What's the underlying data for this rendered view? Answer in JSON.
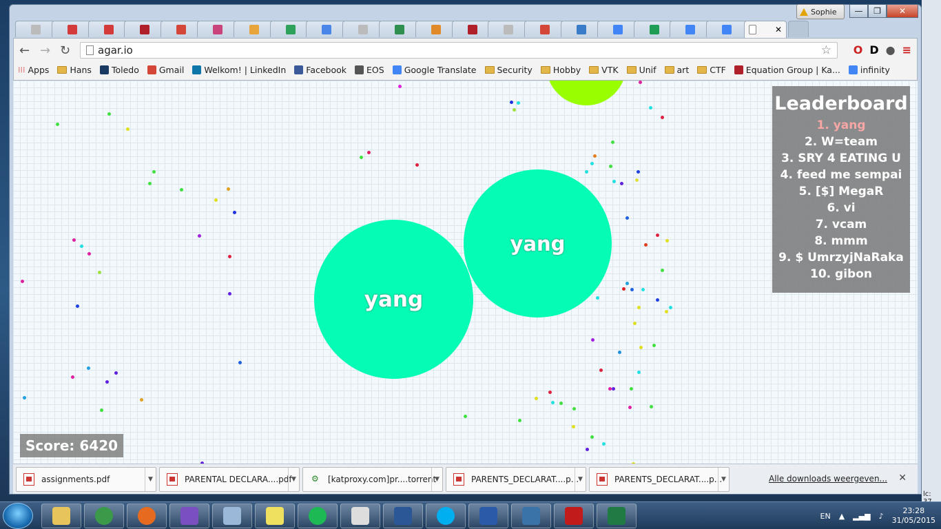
{
  "profile": {
    "name": "Sophie"
  },
  "window_controls": {
    "minimize": "—",
    "maximize": "❐",
    "close": "✕"
  },
  "tabs": [
    {
      "icon": "page-icon",
      "color": "#bbbbbb"
    },
    {
      "icon": "pdf-red-icon",
      "color": "#d33a3a"
    },
    {
      "icon": "pdf-red-icon",
      "color": "#d33a3a"
    },
    {
      "icon": "kaspersky-icon",
      "color": "#b0202a"
    },
    {
      "icon": "gmail-icon",
      "color": "#d44638"
    },
    {
      "icon": "barcode-icon",
      "color": "#c9447a"
    },
    {
      "icon": "pinwheel-icon",
      "color": "#e7a53b"
    },
    {
      "icon": "drive-icon",
      "color": "#2ea15a"
    },
    {
      "icon": "docs-icon",
      "color": "#4a86e8"
    },
    {
      "icon": "page-icon",
      "color": "#bbbbbb"
    },
    {
      "icon": "arrow-icon",
      "color": "#2f8f4e"
    },
    {
      "icon": "gear-icon",
      "color": "#e08a2a"
    },
    {
      "icon": "kaspersky-icon",
      "color": "#b0202a"
    },
    {
      "icon": "page-icon",
      "color": "#bbbbbb"
    },
    {
      "icon": "gmail-icon",
      "color": "#d44638"
    },
    {
      "icon": "home-icon",
      "color": "#3a7cc8"
    },
    {
      "icon": "google-icon",
      "color": "#4285f4"
    },
    {
      "icon": "sheets-icon",
      "color": "#1f9d55"
    },
    {
      "icon": "google-icon",
      "color": "#4285f4"
    },
    {
      "icon": "google-icon",
      "color": "#4285f4"
    }
  ],
  "active_tab": {
    "close": "✕"
  },
  "address": {
    "url": "agar.io"
  },
  "bookmarks": [
    {
      "label": "Apps",
      "type": "apps"
    },
    {
      "label": "Hans",
      "type": "folder"
    },
    {
      "label": "Toledo",
      "type": "site",
      "color": "#1b3a63"
    },
    {
      "label": "Gmail",
      "type": "site",
      "color": "#d44638"
    },
    {
      "label": "Welkom! | LinkedIn",
      "type": "site",
      "color": "#0e76a8"
    },
    {
      "label": "Facebook",
      "type": "site",
      "color": "#3b5998"
    },
    {
      "label": "EOS",
      "type": "site",
      "color": "#555555"
    },
    {
      "label": "Google Translate",
      "type": "site",
      "color": "#4285f4"
    },
    {
      "label": "Security",
      "type": "folder"
    },
    {
      "label": "Hobby",
      "type": "folder"
    },
    {
      "label": "VTK",
      "type": "folder"
    },
    {
      "label": "Unif",
      "type": "folder"
    },
    {
      "label": "art",
      "type": "folder"
    },
    {
      "label": "CTF",
      "type": "folder"
    },
    {
      "label": "Equation Group | Ka...",
      "type": "site",
      "color": "#b0202a"
    },
    {
      "label": "infinity",
      "type": "site",
      "color": "#4285f4"
    }
  ],
  "game": {
    "player_name": "yang",
    "score_label": "Score: 6420",
    "cell_color": "#05fcb5",
    "leaderboard": {
      "title": "Leaderboard",
      "entries": [
        "1. yang",
        "2. W=team",
        "3. SRY 4 EATING U",
        "4. feed me sempai",
        "5. [$] MegaR",
        "6. vi",
        "7. vcam",
        "8. mmm",
        "9. $ UmrzyjNaRaka",
        "10. gibon"
      ]
    }
  },
  "downloads": {
    "items": [
      "assignments.pdf",
      "PARENTAL DECLARA....pdf",
      "[katproxy.com]pr....torrent",
      "PARENTS_DECLARAT....p...",
      "PARENTS_DECLARAT....p..."
    ],
    "show_all": "Alle downloads weergeven...",
    "close": "✕"
  },
  "taskbar": {
    "apps": [
      {
        "name": "explorer",
        "color": "#e8c55a"
      },
      {
        "name": "chrome",
        "color": "#3a9a4a"
      },
      {
        "name": "firefox",
        "color": "#e66b1f"
      },
      {
        "name": "cat-app",
        "color": "#7a4fc0"
      },
      {
        "name": "calculator",
        "color": "#9bb8d8"
      },
      {
        "name": "sticky-notes",
        "color": "#f0e060"
      },
      {
        "name": "spotify",
        "color": "#1db954"
      },
      {
        "name": "tex",
        "color": "#dddddd"
      },
      {
        "name": "word",
        "color": "#2b5797"
      },
      {
        "name": "skype",
        "color": "#00aff0"
      },
      {
        "name": "powershell",
        "color": "#2a5aa8"
      },
      {
        "name": "python",
        "color": "#3a73a8"
      },
      {
        "name": "acrobat",
        "color": "#c21b1b"
      },
      {
        "name": "excel",
        "color": "#1f7a44"
      }
    ],
    "language": "EN",
    "time": "23:28",
    "date": "31/05/2015"
  },
  "side_label": "lc: 37"
}
